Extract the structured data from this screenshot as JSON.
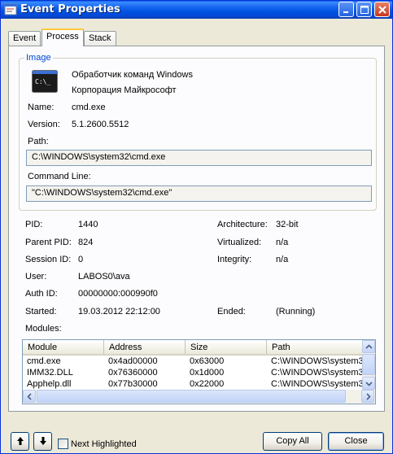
{
  "window": {
    "title": "Event Properties"
  },
  "tabs": [
    {
      "label": "Event",
      "active": false
    },
    {
      "label": "Process",
      "active": true
    },
    {
      "label": "Stack",
      "active": false
    }
  ],
  "image_group": {
    "legend": "Image",
    "description": "Обработчик команд Windows",
    "company": "Корпорация Майкрософт",
    "name_label": "Name:",
    "name_value": "cmd.exe",
    "version_label": "Version:",
    "version_value": "5.1.2600.5512",
    "path_label": "Path:",
    "path_value": "C:\\WINDOWS\\system32\\cmd.exe",
    "cmdline_label": "Command Line:",
    "cmdline_value": "\"C:\\WINDOWS\\system32\\cmd.exe\""
  },
  "details": {
    "pid_label": "PID:",
    "pid_value": "1440",
    "ppid_label": "Parent PID:",
    "ppid_value": "824",
    "session_label": "Session ID:",
    "session_value": "0",
    "user_label": "User:",
    "user_value": "LABOS0\\ava",
    "auth_label": "Auth ID:",
    "auth_value": "00000000:000990f0",
    "started_label": "Started:",
    "started_value": "19.03.2012 22:12:00",
    "arch_label": "Architecture:",
    "arch_value": "32-bit",
    "virt_label": "Virtualized:",
    "virt_value": "n/a",
    "integrity_label": "Integrity:",
    "integrity_value": "n/a",
    "ended_label": "Ended:",
    "ended_value": "(Running)",
    "modules_label": "Modules:"
  },
  "modules": {
    "columns": [
      "Module",
      "Address",
      "Size",
      "Path"
    ],
    "rows": [
      [
        "cmd.exe",
        "0x4ad00000",
        "0x63000",
        "C:\\WINDOWS\\system3"
      ],
      [
        "IMM32.DLL",
        "0x76360000",
        "0x1d000",
        "C:\\WINDOWS\\system3"
      ],
      [
        "Apphelp.dll",
        "0x77b30000",
        "0x22000",
        "C:\\WINDOWS\\system3"
      ]
    ]
  },
  "footer": {
    "next_highlighted_label": "Next Highlighted",
    "copy_all_label": "Copy All",
    "close_label": "Close"
  },
  "icons": {
    "title_icon": "event-properties-icon",
    "cmd_icon": "console-icon",
    "up_arrow": "arrow-up-icon",
    "down_arrow": "arrow-down-icon"
  },
  "colors": {
    "titlebar": "#0052e0",
    "legend_text": "#0046d5",
    "tab_highlight": "#ffc83c",
    "window_bg": "#ece9d8"
  }
}
